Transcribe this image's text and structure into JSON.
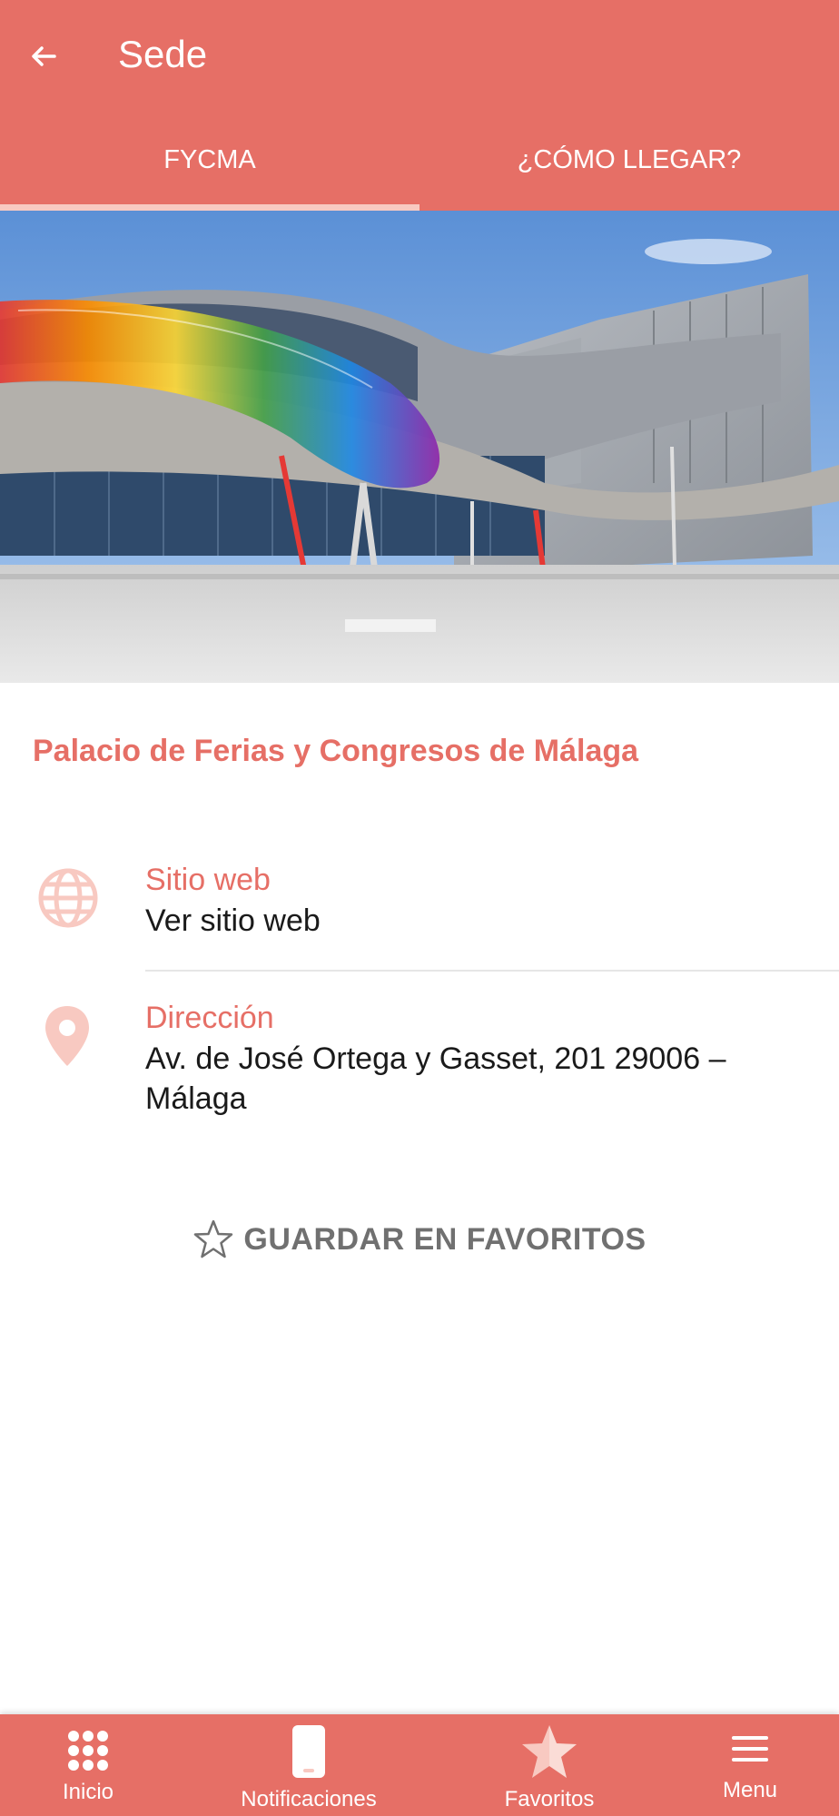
{
  "header": {
    "title": "Sede",
    "tabs": [
      {
        "label": "FYCMA",
        "active": true
      },
      {
        "label": "¿CÓMO LLEGAR?",
        "active": false
      }
    ]
  },
  "venue": {
    "name": "Palacio de Ferias y Congresos de Málaga"
  },
  "info": {
    "website": {
      "label": "Sitio web",
      "value": "Ver sitio web",
      "icon": "globe-icon"
    },
    "address": {
      "label": "Dirección",
      "value": "Av. de José Ortega y Gasset, 201 29006 – Málaga",
      "icon": "map-pin-icon"
    }
  },
  "favorite_button": {
    "label": "GUARDAR EN FAVORITOS",
    "icon": "star-outline-icon"
  },
  "bottom_nav": [
    {
      "label": "Inicio",
      "icon": "grid-icon"
    },
    {
      "label": "Notificaciones",
      "icon": "phone-icon"
    },
    {
      "label": "Favoritos",
      "icon": "star-icon"
    },
    {
      "label": "Menu",
      "icon": "menu-icon"
    }
  ],
  "colors": {
    "primary": "#e66f66",
    "accent_light": "#f8c9c1",
    "text_dark": "#1a1a1a",
    "text_muted": "#707070"
  }
}
